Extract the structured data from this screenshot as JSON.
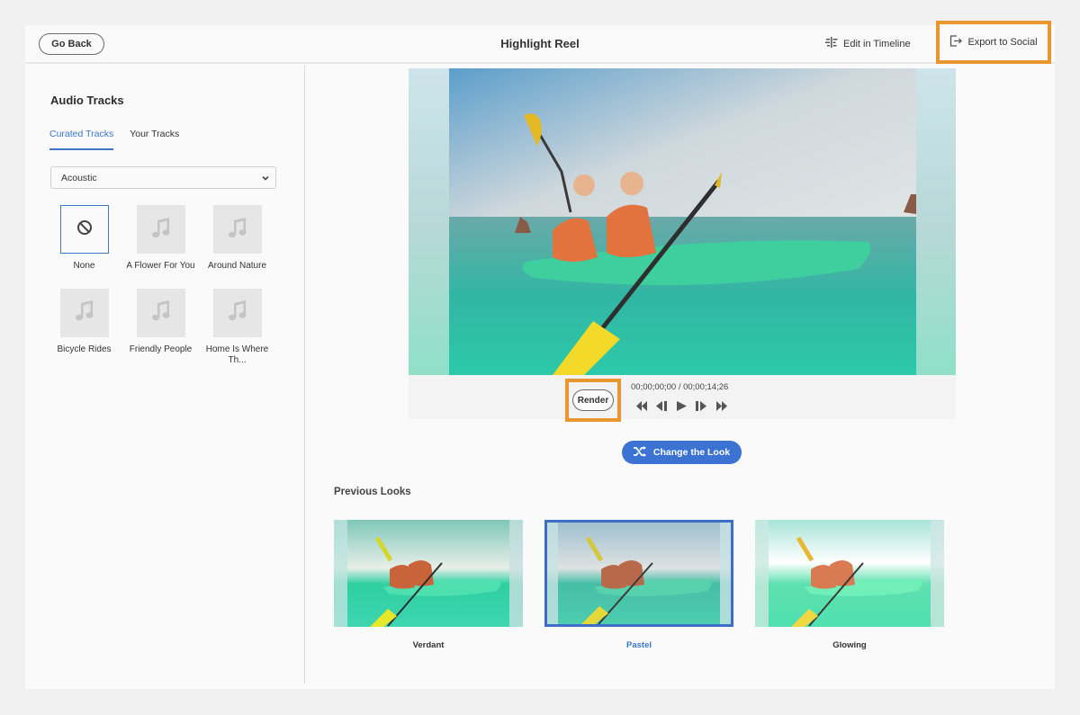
{
  "header": {
    "go_back_label": "Go Back",
    "title": "Highlight Reel",
    "edit_timeline_label": "Edit in Timeline",
    "export_label": "Export to Social"
  },
  "sidebar": {
    "heading": "Audio Tracks",
    "tabs": [
      {
        "label": "Curated Tracks",
        "active": true
      },
      {
        "label": "Your Tracks",
        "active": false
      }
    ],
    "genre_select": {
      "value": "Acoustic"
    },
    "tracks": [
      {
        "label": "None",
        "icon": "no-symbol-icon",
        "selected": true
      },
      {
        "label": "A Flower For You",
        "icon": "music-note-icon"
      },
      {
        "label": "Around Nature",
        "icon": "music-note-icon"
      },
      {
        "label": "Bicycle Rides",
        "icon": "music-note-icon"
      },
      {
        "label": "Friendly People",
        "icon": "music-note-icon"
      },
      {
        "label": "Home Is Where Th...",
        "icon": "music-note-icon"
      }
    ]
  },
  "player": {
    "render_label": "Render",
    "timecode": "00;00;00;00 / 00;00;14;26",
    "transport": [
      "skip-to-start-icon",
      "step-back-icon",
      "play-icon",
      "step-forward-icon",
      "skip-to-end-icon"
    ]
  },
  "change_look_label": "Change the Look",
  "previous_looks": {
    "heading": "Previous Looks",
    "items": [
      {
        "label": "Verdant",
        "selected": false
      },
      {
        "label": "Pastel",
        "selected": true
      },
      {
        "label": "Glowing",
        "selected": false
      }
    ]
  },
  "colors": {
    "accent": "#3c73d2",
    "highlight": "#e8962d"
  }
}
